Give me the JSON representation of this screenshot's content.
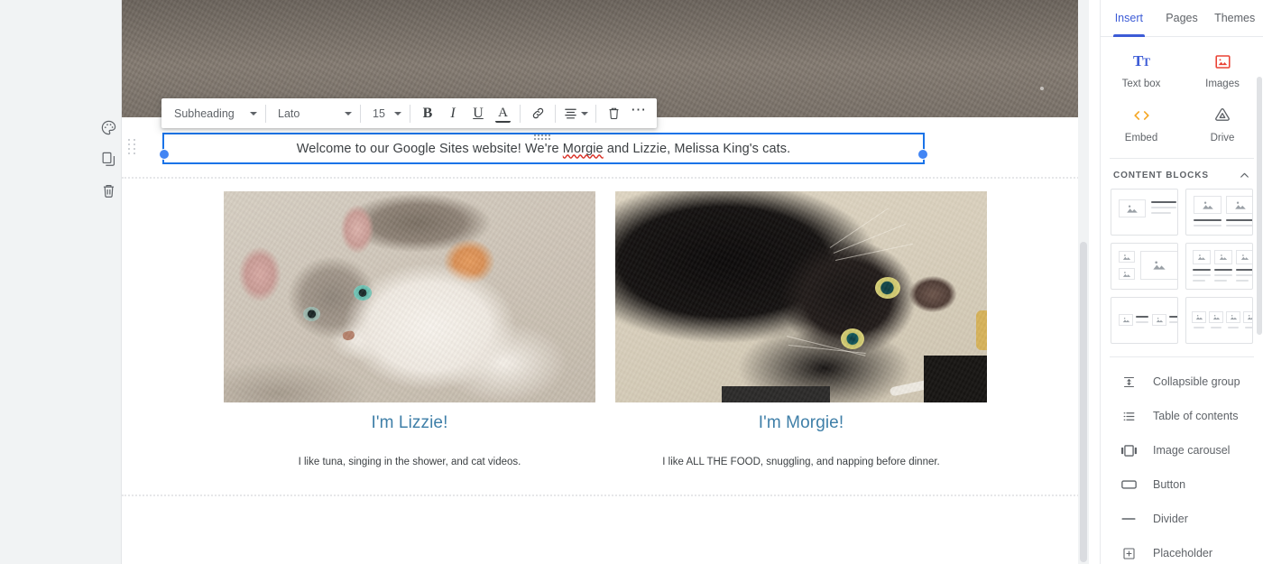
{
  "gutter": {
    "tools": [
      {
        "name": "palette-icon",
        "label": "Theme"
      },
      {
        "name": "duplicate-icon",
        "label": "Duplicate section"
      },
      {
        "name": "trash-icon",
        "label": "Delete section"
      }
    ]
  },
  "format_toolbar": {
    "style": "Subheading",
    "font": "Lato",
    "size": "15",
    "bold_label": "B",
    "italic_label": "I",
    "underline_label": "U",
    "text_color_label": "A",
    "link_label": "Link",
    "align_label": "Align",
    "delete_label": "Delete",
    "more_label": "⋯"
  },
  "textbox": {
    "text_before": "Welcome to our Google Sites website! We're ",
    "misspelled_word": "Morgie",
    "text_after": " and Lizzie, Melissa King's cats.",
    "selection_color": "#1a73e8",
    "handle_color": "#4285f4"
  },
  "cards": [
    {
      "photo_name": "lizzie-cat-photo",
      "photo_alt": "Calico tabby cat lying on carpet",
      "title": "I'm Lizzie!",
      "caption": "I like tuna, singing in the shower, and cat videos."
    },
    {
      "photo_name": "morgie-cat-photo",
      "photo_alt": "Black cat lying on its back on carpet",
      "title": "I'm Morgie!",
      "caption": "I like ALL THE FOOD, snuggling, and napping before dinner."
    }
  ],
  "card_title_color": "#3f7fa8",
  "panel": {
    "tabs": [
      {
        "label": "Insert",
        "active": true
      },
      {
        "label": "Pages",
        "active": false
      },
      {
        "label": "Themes",
        "active": false
      }
    ],
    "accent_color": "#3c5bd6",
    "quick_inserts": [
      {
        "icon": "text-box-icon",
        "label": "Text box"
      },
      {
        "icon": "images-icon",
        "label": "Images"
      },
      {
        "icon": "embed-icon",
        "label": "Embed"
      },
      {
        "icon": "drive-icon",
        "label": "Drive"
      }
    ],
    "content_blocks_header": "CONTENT BLOCKS",
    "content_blocks": [
      {
        "name": "block-image-left-text-right"
      },
      {
        "name": "block-two-images-with-text"
      },
      {
        "name": "block-two-small-one-large-image"
      },
      {
        "name": "block-three-images-with-text"
      },
      {
        "name": "block-two-image-text-pairs-inline"
      },
      {
        "name": "block-four-images-with-captions"
      }
    ],
    "blocks": [
      {
        "icon": "collapsible-group-icon",
        "label": "Collapsible group"
      },
      {
        "icon": "table-of-contents-icon",
        "label": "Table of contents"
      },
      {
        "icon": "image-carousel-icon",
        "label": "Image carousel"
      },
      {
        "icon": "button-icon",
        "label": "Button"
      },
      {
        "icon": "divider-icon",
        "label": "Divider"
      },
      {
        "icon": "placeholder-icon",
        "label": "Placeholder"
      }
    ]
  }
}
